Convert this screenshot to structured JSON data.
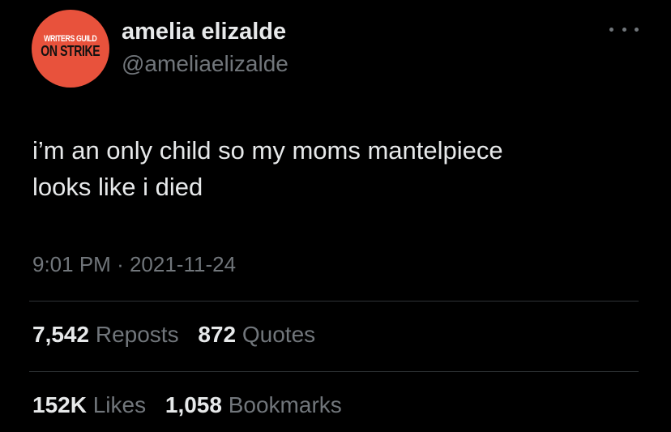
{
  "avatar": {
    "line1": "WRITERS GUILD",
    "line2": "ON STRIKE",
    "background_color": "#e8523c"
  },
  "author": {
    "display_name": "amelia elizalde",
    "handle": "@ameliaelizalde"
  },
  "more_menu_icon": "ellipsis-icon",
  "tweet": {
    "lines": [
      "i’m an only child so my moms mantelpiece",
      "looks like i died"
    ]
  },
  "meta": {
    "time": "9:01 PM",
    "separator": "·",
    "date": "2021-11-24"
  },
  "stats_row1": [
    {
      "value": "7,542",
      "label": "Reposts"
    },
    {
      "value": "872",
      "label": "Quotes"
    }
  ],
  "stats_row2": [
    {
      "value": "152K",
      "label": "Likes"
    },
    {
      "value": "1,058",
      "label": "Bookmarks"
    }
  ],
  "colors": {
    "background": "#000000",
    "primary_text": "#e7e9ea",
    "secondary_text": "#71767b",
    "divider": "#2f3336"
  }
}
